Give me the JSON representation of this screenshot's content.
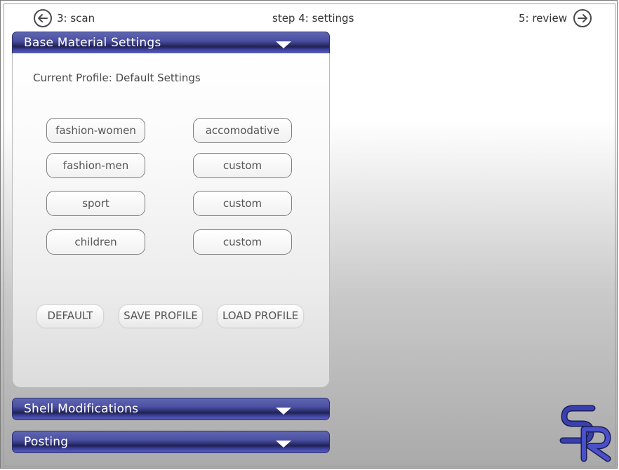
{
  "nav": {
    "prev_label": "3: scan",
    "current_step": "step 4: settings",
    "next_label": "5: review"
  },
  "sections": {
    "base": {
      "title": "Base Material Settings"
    },
    "shell": {
      "title": "Shell Modifications"
    },
    "posting": {
      "title": "Posting"
    }
  },
  "base_panel": {
    "current_profile": "Current Profile: Default Settings",
    "profiles_left": [
      "fashion-women",
      "fashion-men",
      "sport",
      "children"
    ],
    "profiles_right": [
      "accomodative",
      "custom",
      "custom",
      "custom"
    ],
    "actions": {
      "default": "DEFAULT",
      "save": "SAVE PROFILE",
      "load": "LOAD PROFILE"
    }
  },
  "colors": {
    "section_bar": "#4b4fa1",
    "logo": "#3a3fb0"
  },
  "icons": {
    "prev": "arrow-left-circle-icon",
    "next": "arrow-right-circle-icon",
    "expand": "triangle-down-icon",
    "logo": "sr-logo"
  }
}
